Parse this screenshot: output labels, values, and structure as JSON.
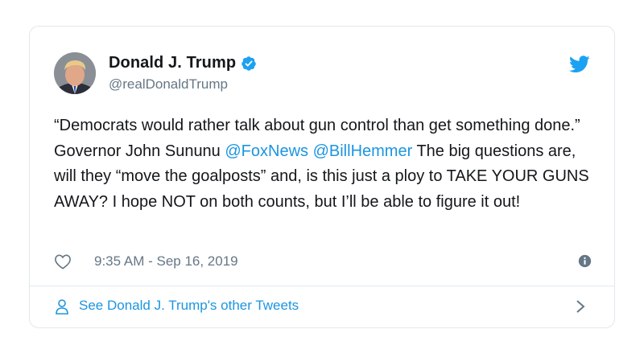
{
  "tweet": {
    "display_name": "Donald J. Trump",
    "handle": "@realDonaldTrump",
    "text_1": "“Democrats would rather talk about gun control than get something done.” Governor John Sununu ",
    "mention_1": "@FoxNews",
    "text_2": " ",
    "mention_2": "@BillHemmer",
    "text_3": " The big questions are, will they “move the goalposts” and, is this just a ploy to TAKE YOUR GUNS AWAY? I hope NOT on both counts, but I’ll be able to figure it out!",
    "timestamp": "9:35 AM - Sep 16, 2019"
  },
  "footer": {
    "link_label": "See Donald J. Trump's other Tweets"
  },
  "colors": {
    "link": "#1b95e0",
    "secondary_text": "#657786",
    "border": "#e1e8ed",
    "verified": "#1da1f2"
  },
  "icons": [
    "verified-badge-icon",
    "twitter-bird-icon",
    "heart-icon",
    "info-icon",
    "person-icon",
    "chevron-right-icon"
  ]
}
